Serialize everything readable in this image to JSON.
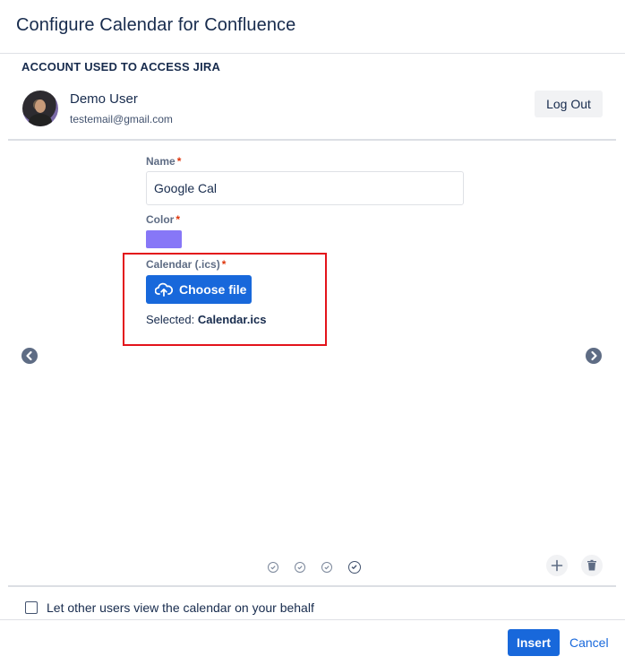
{
  "dialog": {
    "title": "Configure Calendar for Confluence"
  },
  "account": {
    "heading": "ACCOUNT USED TO ACCESS JIRA",
    "user_name": "Demo User",
    "user_email": "testemail@gmail.com",
    "logout_label": "Log Out"
  },
  "form": {
    "name_label": "Name",
    "name_value": "Google Cal",
    "color_label": "Color",
    "color_value": "#8777f7",
    "calendar_label": "Calendar (.ics)",
    "required_marker": "*",
    "choose_file_label": "Choose file",
    "selected_prefix": "Selected:",
    "selected_file": "Calendar.ics"
  },
  "wizard": {
    "steps": [
      {
        "state": "inactive"
      },
      {
        "state": "inactive"
      },
      {
        "state": "inactive"
      },
      {
        "state": "active"
      }
    ]
  },
  "footer": {
    "share_label": "Let other users view the calendar on your behalf",
    "share_checked": false,
    "insert_label": "Insert",
    "cancel_label": "Cancel"
  },
  "icons": {
    "prev": "chevron-left-icon",
    "next": "chevron-right-icon",
    "upload": "cloud-upload-icon",
    "add": "plus-icon",
    "delete": "trash-icon",
    "step": "check-circle-icon"
  },
  "colors": {
    "primary": "#1868db",
    "highlight": "#e3131b",
    "required": "#de350b",
    "swatch": "#8777f7"
  }
}
